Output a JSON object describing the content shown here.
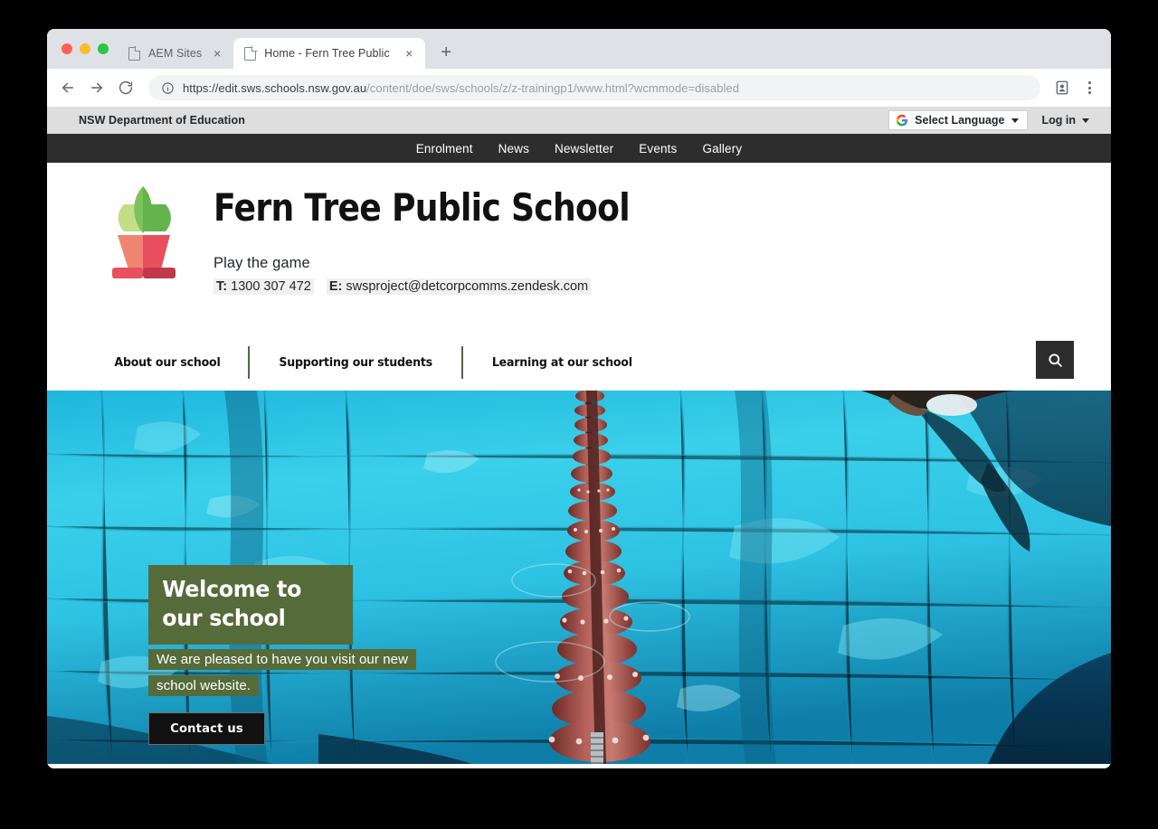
{
  "browser": {
    "tabs": [
      {
        "title": "AEM Sites",
        "active": false,
        "favicon": "page-icon",
        "close": "×"
      },
      {
        "title": "Home - Fern Tree Public Schoo",
        "active": true,
        "favicon": "page-icon",
        "close": "×"
      }
    ],
    "new_tab_label": "+",
    "back_icon": "back-arrow-icon",
    "forward_icon": "forward-arrow-icon",
    "reload_icon": "reload-icon",
    "url_secure_icon": "info-circle-icon",
    "url_host": "https://edit.sws.schools.nsw.gov.au",
    "url_path": "/content/doe/sws/schools/z/z-trainingp1/www.html?wcmmode=disabled",
    "profile_icon": "profile-card-icon",
    "menu_icon": "kebab-menu-icon"
  },
  "utility_bar": {
    "department": "NSW Department of Education",
    "language_select": "Select Language",
    "language_icon": "google-g-icon",
    "login": "Log in"
  },
  "topnav": {
    "items": [
      {
        "label": "Enrolment"
      },
      {
        "label": "News"
      },
      {
        "label": "Newsletter"
      },
      {
        "label": "Events"
      },
      {
        "label": "Gallery"
      }
    ]
  },
  "masthead": {
    "logo_alt": "plant-in-pot-logo",
    "school_name": "Fern Tree Public School",
    "motto": "Play the game",
    "phone_label": "T:",
    "phone": "1300 307 472",
    "email_label": "E:",
    "email": "swsproject@detcorpcomms.zendesk.com"
  },
  "mainnav": {
    "items": [
      {
        "label": "About our school"
      },
      {
        "label": "Supporting our students"
      },
      {
        "label": "Learning at our school"
      }
    ],
    "search_icon": "search-icon"
  },
  "hero": {
    "image_alt": "swimming-pool-lane-rope-photo",
    "title": "Welcome to our school",
    "subtitle": "We are pleased to have you visit our new school website.",
    "cta": "Contact us"
  },
  "colors": {
    "accent_green": "#566b3a",
    "nav_divider_green": "#4d6b3c",
    "dark_nav": "#2d2d2d",
    "utility_grey": "#dedede",
    "pool_blue": "#2ec6e8",
    "lane_rope_red": "#8d3a32"
  }
}
